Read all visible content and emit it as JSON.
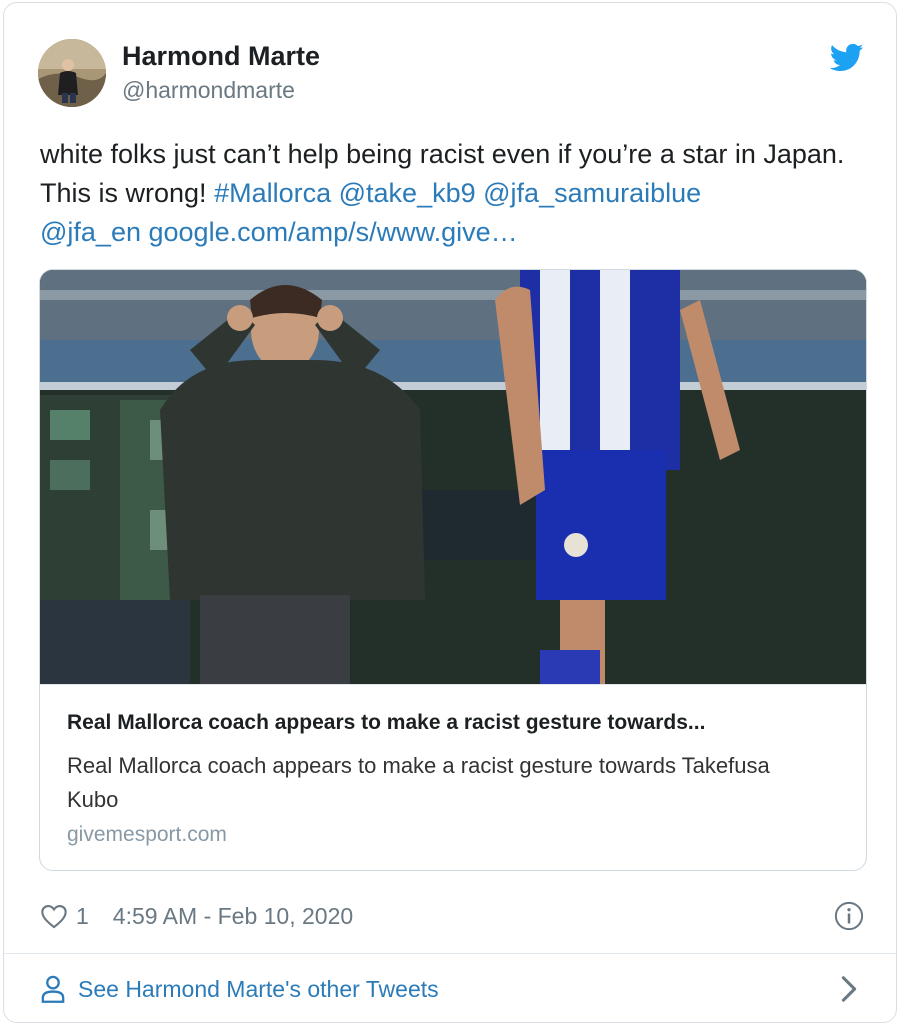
{
  "tweet": {
    "author": {
      "display_name": "Harmond Marte",
      "handle": "@harmondmarte"
    },
    "text": {
      "segments": [
        {
          "text": "white folks just can’t help being racist even if you’re a star in Japan. This is wrong! ",
          "type": "plain"
        },
        {
          "text": "#Mallorca",
          "type": "hashtag"
        },
        {
          "text": " ",
          "type": "plain"
        },
        {
          "text": "@take_kb9",
          "type": "mention"
        },
        {
          "text": " ",
          "type": "plain"
        },
        {
          "text": "@jfa_samuraiblue",
          "type": "mention"
        },
        {
          "text": " ",
          "type": "plain"
        },
        {
          "text": "@jfa_en",
          "type": "mention"
        },
        {
          "text": " ",
          "type": "plain"
        },
        {
          "text": "google.com/amp/s/www.give…",
          "type": "link"
        }
      ]
    },
    "card": {
      "image_icon": "soccer-sideline-photo",
      "title": "Real Mallorca coach appears to make a racist gesture towards...",
      "description": "Real Mallorca coach appears to make a racist gesture towards Takefusa Kubo",
      "domain": "givemesport.com"
    },
    "meta": {
      "like_count": "1",
      "timestamp": "4:59 AM - Feb 10, 2020"
    },
    "footer": {
      "other_tweets_label": "See Harmond Marte's other Tweets"
    }
  },
  "colors": {
    "link": "#2b7bb9",
    "twitter_blue": "#1da1f2",
    "muted": "#697882",
    "text": "#1c2022",
    "border": "#d9dfe4"
  },
  "icons": {
    "brand": "twitter-bird-icon",
    "like": "heart-icon",
    "info": "info-icon",
    "profile": "person-icon",
    "navigate": "chevron-right-icon"
  }
}
